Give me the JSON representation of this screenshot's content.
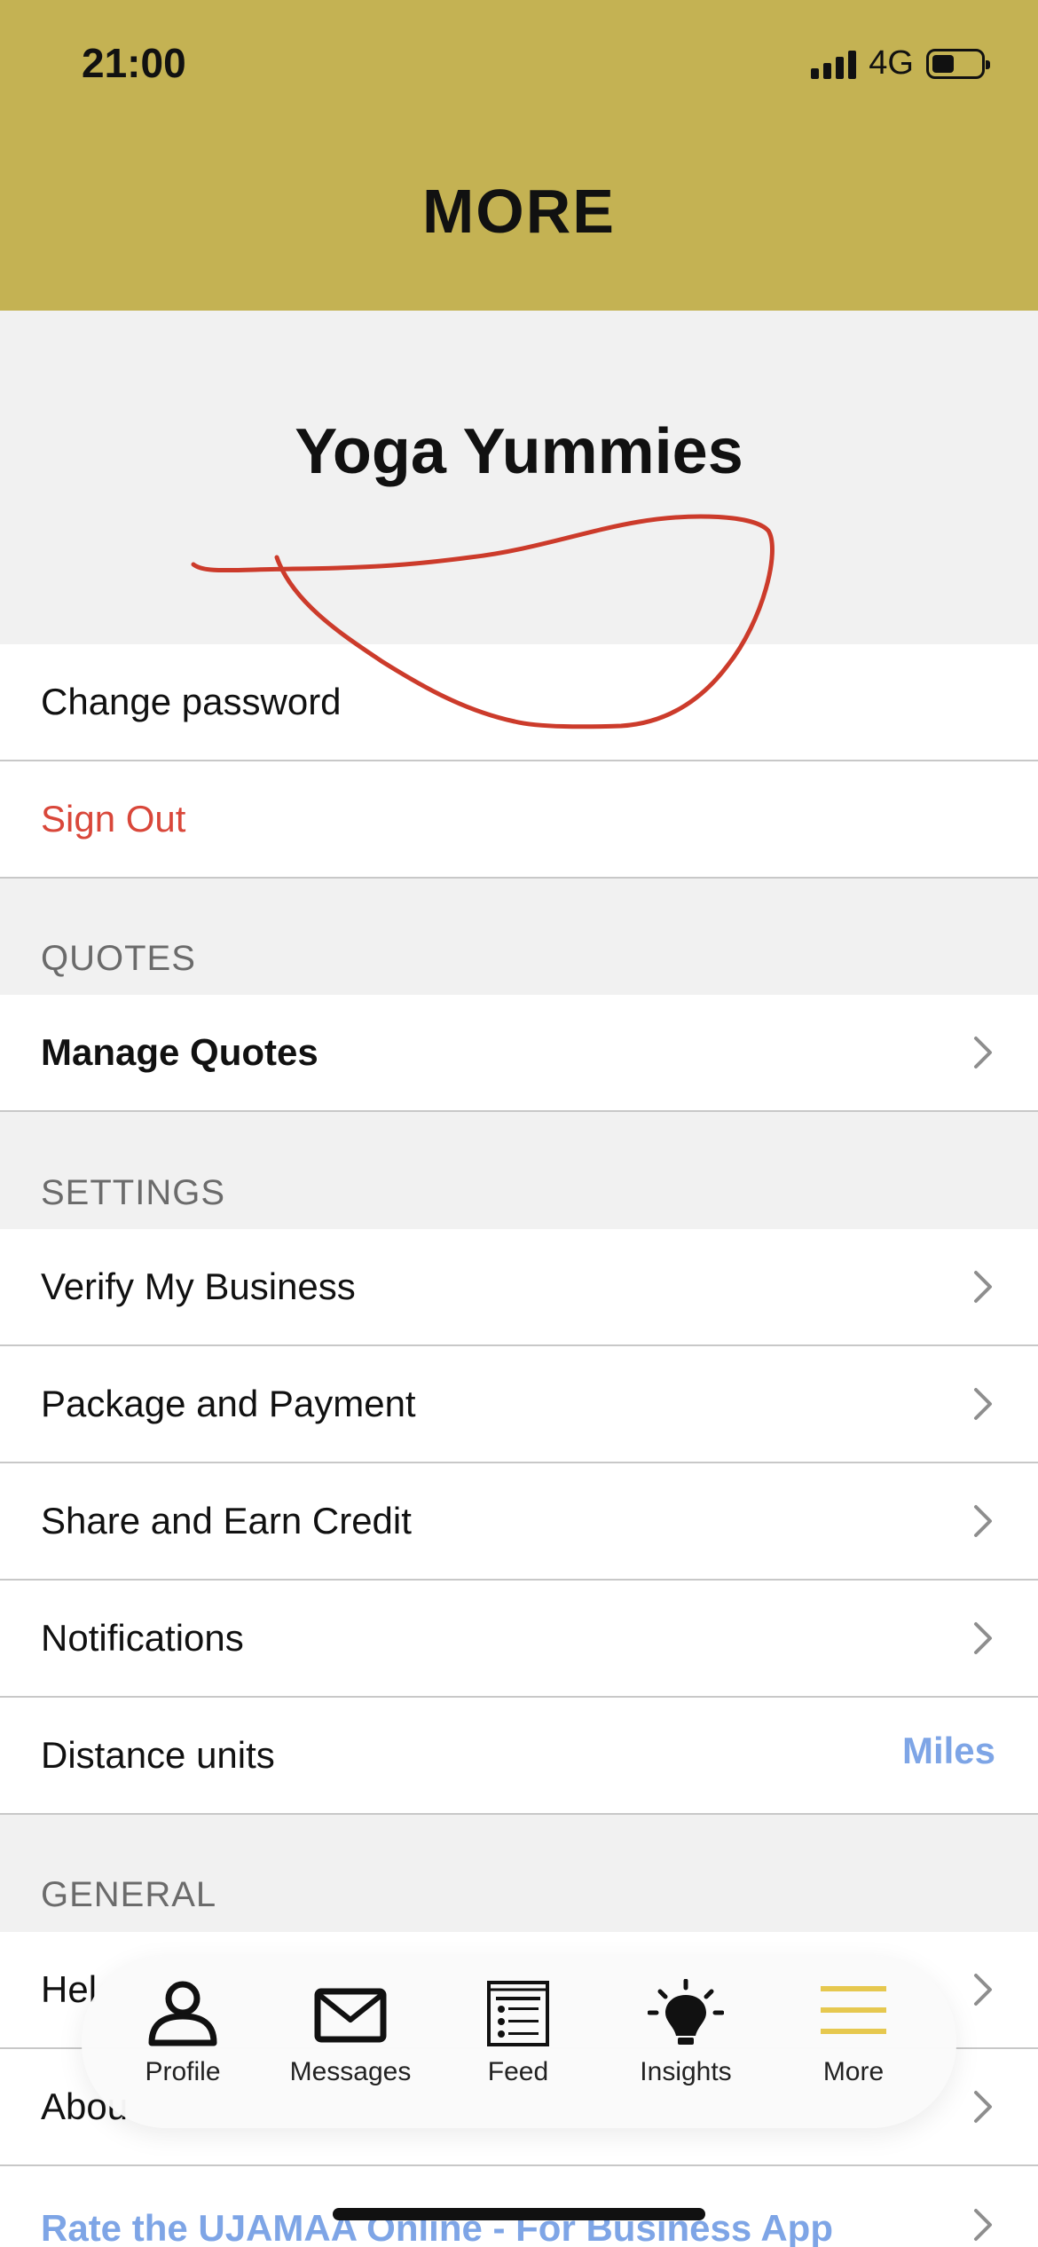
{
  "status_bar": {
    "time": "21:00",
    "network": "4G"
  },
  "header": {
    "title": "MORE"
  },
  "profile": {
    "business_name": "Yoga Yummies"
  },
  "account": {
    "change_password": "Change password",
    "sign_out": "Sign Out"
  },
  "quotes": {
    "header": "QUOTES",
    "manage_quotes": "Manage Quotes"
  },
  "settings": {
    "header": "SETTINGS",
    "items": [
      {
        "label": "Verify My Business"
      },
      {
        "label": "Package and Payment"
      },
      {
        "label": "Share and Earn Credit"
      },
      {
        "label": "Notifications"
      }
    ],
    "distance_units_label": "Distance units",
    "distance_units_value": "Miles"
  },
  "general": {
    "header": "GENERAL",
    "help_partial": "Hel",
    "about_partial": "Abou",
    "rate_app": "Rate the UJAMAA Online - For Business App"
  },
  "tabbar": {
    "tabs": [
      {
        "label": "Profile",
        "icon": "person-icon"
      },
      {
        "label": "Messages",
        "icon": "envelope-icon"
      },
      {
        "label": "Feed",
        "icon": "feed-icon"
      },
      {
        "label": "Insights",
        "icon": "lightbulb-icon"
      },
      {
        "label": "More",
        "icon": "hamburger-menu-icon"
      }
    ]
  },
  "colors": {
    "header_bg": "#c4b253",
    "sign_out": "#d9473a",
    "accent_link": "#7ea5e6",
    "annotation": "#cc3b2b",
    "more_icon": "#e6c84f"
  }
}
